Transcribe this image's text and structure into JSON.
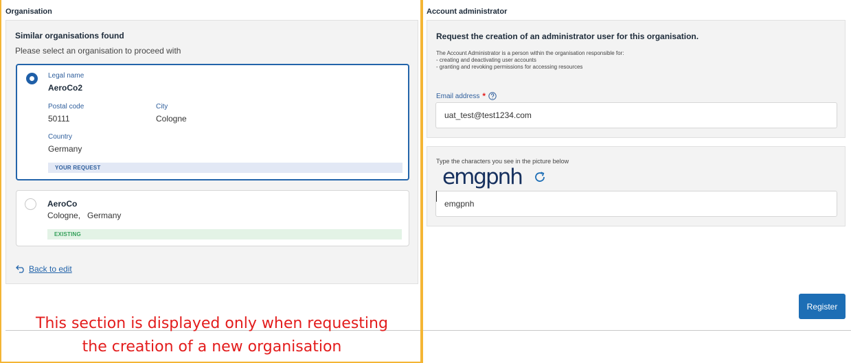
{
  "organisation": {
    "section_title": "Organisation",
    "heading": "Similar organisations found",
    "subheading": "Please select an organisation to proceed with",
    "candidates": [
      {
        "selected": true,
        "legal_name_label": "Legal name",
        "legal_name": "AeroCo2",
        "postal_code_label": "Postal code",
        "postal_code": "50111",
        "city_label": "City",
        "city": "Cologne",
        "country_label": "Country",
        "country": "Germany",
        "badge": "YOUR REQUEST"
      },
      {
        "selected": false,
        "name": "AeroCo",
        "location": "Cologne,   Germany",
        "badge": "EXISTING"
      }
    ],
    "back_link": "Back to edit"
  },
  "note": {
    "line1": "This section is displayed only when requesting",
    "line2": "the creation of a new organisation"
  },
  "account": {
    "section_title": "Account administrator",
    "heading": "Request the creation of an administrator user for this organisation.",
    "description": [
      "The Account Administrator is a person within the organisation responsible for:",
      "- creating and deactivating user accounts",
      "- granting and revoking permissions for accessing resources"
    ],
    "email_label": "Email address",
    "required_mark": "*",
    "email_value": "uat_test@test1234.com"
  },
  "captcha": {
    "label": "Type the characters you see in the picture below",
    "image_text": "emgpnh",
    "input_value": "emgpnh"
  },
  "actions": {
    "register_label": "Register"
  },
  "colors": {
    "highlight_frame": "#f4b534",
    "primary": "#1d6eb5",
    "note_red": "#e31c1c",
    "existing_green": "#34a05a"
  }
}
